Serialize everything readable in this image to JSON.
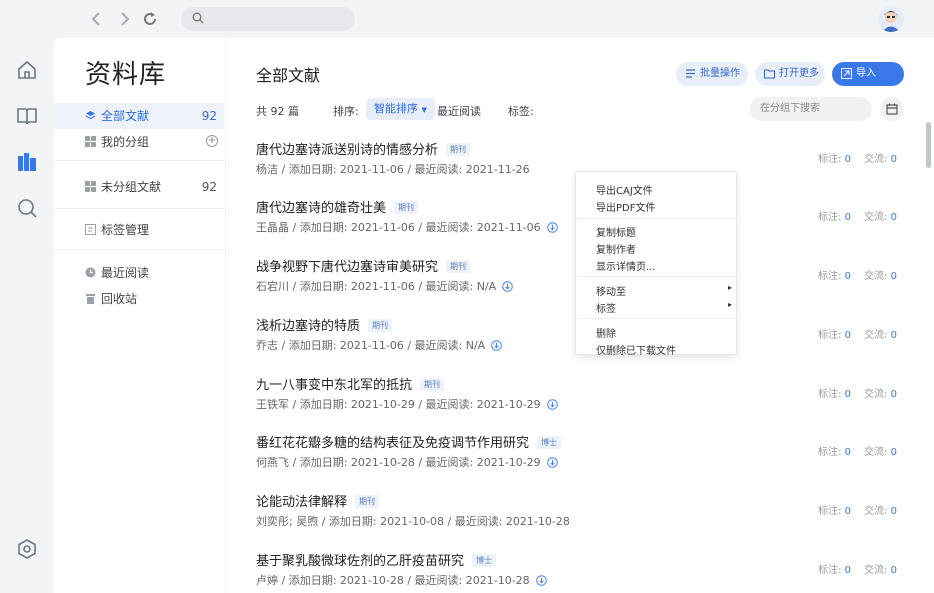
{
  "library": {
    "title": "资料库",
    "items": [
      {
        "label": "全部文献",
        "count": "92"
      },
      {
        "label": "我的分组"
      },
      {
        "label": "未分组文献",
        "count": "92"
      },
      {
        "label": "标签管理"
      },
      {
        "label": "最近阅读"
      },
      {
        "label": "回收站"
      }
    ]
  },
  "main": {
    "title": "全部文献",
    "buttons": {
      "batch": "批量操作",
      "open_more": "打开更多",
      "import": "导入"
    },
    "total": "共 92 篇",
    "sort_label": "排序:",
    "sort_selected": "智能排序",
    "recent": "最近阅读",
    "tags_label": "标签:",
    "search_placeholder": "在分组下搜索"
  },
  "documents": [
    {
      "title": "唐代边塞诗派送别诗的情感分析",
      "badge": "期刊",
      "meta": "杨洁 / 添加日期: 2021-11-06 / 最近阅读: 2021-11-26",
      "download": false,
      "note_label": "标注:",
      "note": "0",
      "comm_label": "交流:",
      "comm": "0"
    },
    {
      "title": "唐代边塞诗的雄奇壮美",
      "badge": "期刊",
      "meta": "王晶晶 / 添加日期: 2021-11-06 / 最近阅读: 2021-11-06",
      "download": true,
      "note_label": "标注:",
      "note": "0",
      "comm_label": "交流:",
      "comm": "0"
    },
    {
      "title": "战争视野下唐代边塞诗审美研究",
      "badge": "期刊",
      "meta": "石宕川 / 添加日期: 2021-11-06 / 最近阅读: N/A",
      "download": true,
      "note_label": "标注:",
      "note": "0",
      "comm_label": "交流:",
      "comm": "0"
    },
    {
      "title": "浅析边塞诗的特质",
      "badge": "期刊",
      "meta": "乔志 / 添加日期: 2021-11-06 / 最近阅读: N/A",
      "download": true,
      "note_label": "标注:",
      "note": "0",
      "comm_label": "交流:",
      "comm": "0"
    },
    {
      "title": "九一八事变中东北军的抵抗",
      "badge": "期刊",
      "meta": "王铁军 / 添加日期: 2021-10-29 / 最近阅读: 2021-10-29",
      "download": true,
      "note_label": "标注:",
      "note": "0",
      "comm_label": "交流:",
      "comm": "0"
    },
    {
      "title": "番红花花瓣多糖的结构表征及免疫调节作用研究",
      "badge": "博士",
      "meta": "何燕飞 / 添加日期: 2021-10-28 / 最近阅读: 2021-10-29",
      "download": true,
      "note_label": "标注:",
      "note": "0",
      "comm_label": "交流:",
      "comm": "0"
    },
    {
      "title": "论能动法律解释",
      "badge": "期刊",
      "meta": "刘奕彤; 吴煦 / 添加日期: 2021-10-08 / 最近阅读: 2021-10-28",
      "download": false,
      "note_label": "标注:",
      "note": "0",
      "comm_label": "交流:",
      "comm": "0"
    },
    {
      "title": "基于聚乳酸微球佐剂的乙肝疫苗研究",
      "badge": "博士",
      "meta": "卢婷 / 添加日期: 2021-10-28 / 最近阅读: 2021-10-28",
      "download": true,
      "note_label": "标注:",
      "note": "0",
      "comm_label": "交流:",
      "comm": "0"
    }
  ],
  "context_menu": {
    "items": [
      "导出CAJ文件",
      "导出PDF文件",
      "复制标题",
      "复制作者",
      "显示详情页...",
      "移动至",
      "标签",
      "删除",
      "仅删除已下载文件"
    ]
  },
  "colors": {
    "accent": "#3878e8",
    "active_bg": "#eef2f9"
  }
}
